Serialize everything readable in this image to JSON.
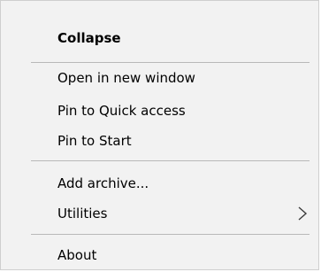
{
  "menu": {
    "items": {
      "collapse": "Collapse",
      "open_new_window": "Open in new window",
      "pin_quick_access": "Pin to Quick access",
      "pin_start": "Pin to Start",
      "add_archive": "Add archive...",
      "utilities": "Utilities",
      "about": "About"
    },
    "icons": {
      "submenu": "chevron-right-icon"
    },
    "colors": {
      "background": "#f2f2f2",
      "separator": "#b9b9b9",
      "text": "#000000"
    }
  }
}
